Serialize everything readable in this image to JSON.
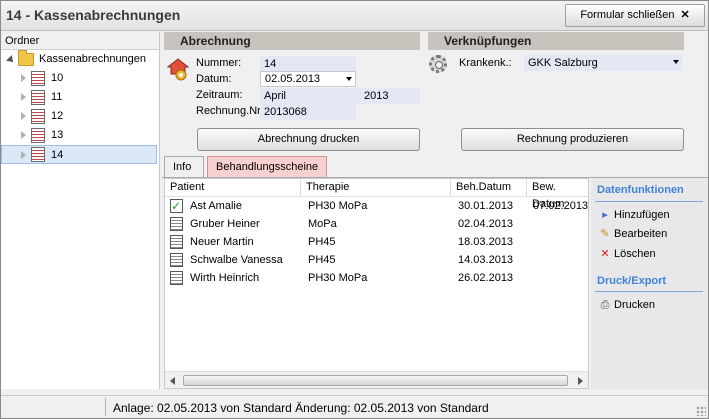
{
  "window": {
    "title": "14 - Kassenabrechnungen",
    "close_label": "Formular schließen",
    "close_glyph": "✕"
  },
  "tree": {
    "header": "Ordner",
    "root": "Kassenabrechnungen",
    "items": [
      "10",
      "11",
      "12",
      "13",
      "14"
    ],
    "selected": "14"
  },
  "abrechnung": {
    "header": "Abrechnung",
    "nummer_label": "Nummer:",
    "nummer": "14",
    "datum_label": "Datum:",
    "datum": "02.05.2013",
    "zeitraum_label": "Zeitraum:",
    "zeitraum_monat": "April",
    "zeitraum_jahr": "2013",
    "rechnung_label": "Rechnung.Nr",
    "rechnung": "2013068",
    "print_button": "Abrechnung drucken"
  },
  "verknuepfungen": {
    "header": "Verknüpfungen",
    "krankenk_label": "Krankenk.:",
    "krankenk": "GKK Salzburg",
    "produce_button": "Rechnung produzieren"
  },
  "tabs": [
    "Info",
    "Behandlungsscheine"
  ],
  "active_tab": "Behandlungsscheine",
  "table": {
    "columns": [
      "Patient",
      "Therapie",
      "Beh.Datum",
      "Bew. Datum"
    ],
    "rows": [
      {
        "patient": "Ast Amalie",
        "therapie": "PH30 MoPa",
        "beh": "30.01.2013",
        "bew": "07.02.2013",
        "icon": "check-doc-icon"
      },
      {
        "patient": "Gruber Heiner",
        "therapie": "MoPa",
        "beh": "02.04.2013",
        "bew": "",
        "icon": "doc-icon"
      },
      {
        "patient": "Neuer Martin",
        "therapie": "PH45",
        "beh": "18.03.2013",
        "bew": "",
        "icon": "doc-icon"
      },
      {
        "patient": "Schwalbe Vanessa",
        "therapie": "PH45",
        "beh": "14.03.2013",
        "bew": "",
        "icon": "doc-icon"
      },
      {
        "patient": "Wirth Heinrich",
        "therapie": "PH30 MoPa",
        "beh": "26.02.2013",
        "bew": "",
        "icon": "doc-icon"
      }
    ]
  },
  "functions": {
    "data_header": "Datenfunktionen",
    "add": "Hinzufügen",
    "edit": "Bearbeiten",
    "delete": "Löschen",
    "print_header": "Druck/Export",
    "print": "Drucken",
    "accent": "#3f83d8"
  },
  "status": {
    "text": "Anlage: 02.05.2013 von Standard  Änderung: 02.05.2013 von Standard"
  }
}
